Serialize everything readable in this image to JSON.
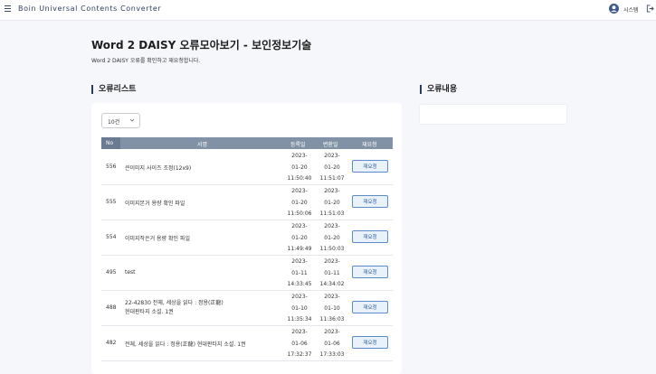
{
  "header": {
    "app_title": "Boin Universal Contents Converter",
    "user_name": "시스템"
  },
  "page": {
    "title": "Word 2 DAISY 오류모아보기 - 보인정보기술",
    "description": "Word 2 DAISY 오류를 확인하고 재요청합니다."
  },
  "error_list": {
    "section_title": "오류리스트",
    "page_size": "10건",
    "columns": {
      "no": "No",
      "title": "서명",
      "registered": "등록일",
      "changed": "변환일",
      "request": "재요청"
    },
    "rows": [
      {
        "no": "556",
        "title": "큰이미지 사이즈 조정(12x9)",
        "reg_date": "2023-",
        "reg_md": "01-20",
        "reg_time": "11:50:40",
        "chg_date": "2023-",
        "chg_md": "01-20",
        "chg_time": "11:51:07",
        "button": "재요청"
      },
      {
        "no": "555",
        "title": "이미지본거 용량 확인 파일",
        "reg_date": "2023-",
        "reg_md": "01-20",
        "reg_time": "11:50:06",
        "chg_date": "2023-",
        "chg_md": "01-20",
        "chg_time": "11:51:03",
        "button": "재요청"
      },
      {
        "no": "554",
        "title": "이미지작은거 용량 확인 파일",
        "reg_date": "2023-",
        "reg_md": "01-20",
        "reg_time": "11:49:49",
        "chg_date": "2023-",
        "chg_md": "01-20",
        "chg_time": "11:50:03",
        "button": "재요청"
      },
      {
        "no": "495",
        "title": "test",
        "reg_date": "2023-",
        "reg_md": "01-11",
        "reg_time": "14:33:45",
        "chg_date": "2023-",
        "chg_md": "01-11",
        "chg_time": "14:34:02",
        "button": "재요청"
      },
      {
        "no": "488",
        "title": "22-42830 전체, 세상을 읽다 : 정용(正龍) 현대판타지 소설. 1권",
        "reg_date": "2023-",
        "reg_md": "01-10",
        "reg_time": "11:35:34",
        "chg_date": "2023-",
        "chg_md": "01-10",
        "chg_time": "11:36:03",
        "button": "재요청"
      },
      {
        "no": "482",
        "title": "전체, 세상을 읽다 : 정용(正龍) 현대판타지 소설. 1권",
        "reg_date": "2023-",
        "reg_md": "01-06",
        "reg_time": "17:32:37",
        "chg_date": "2023-",
        "chg_md": "01-06",
        "chg_time": "17:33:03",
        "button": "재요청"
      }
    ]
  },
  "error_detail": {
    "section_title": "오류내용"
  }
}
